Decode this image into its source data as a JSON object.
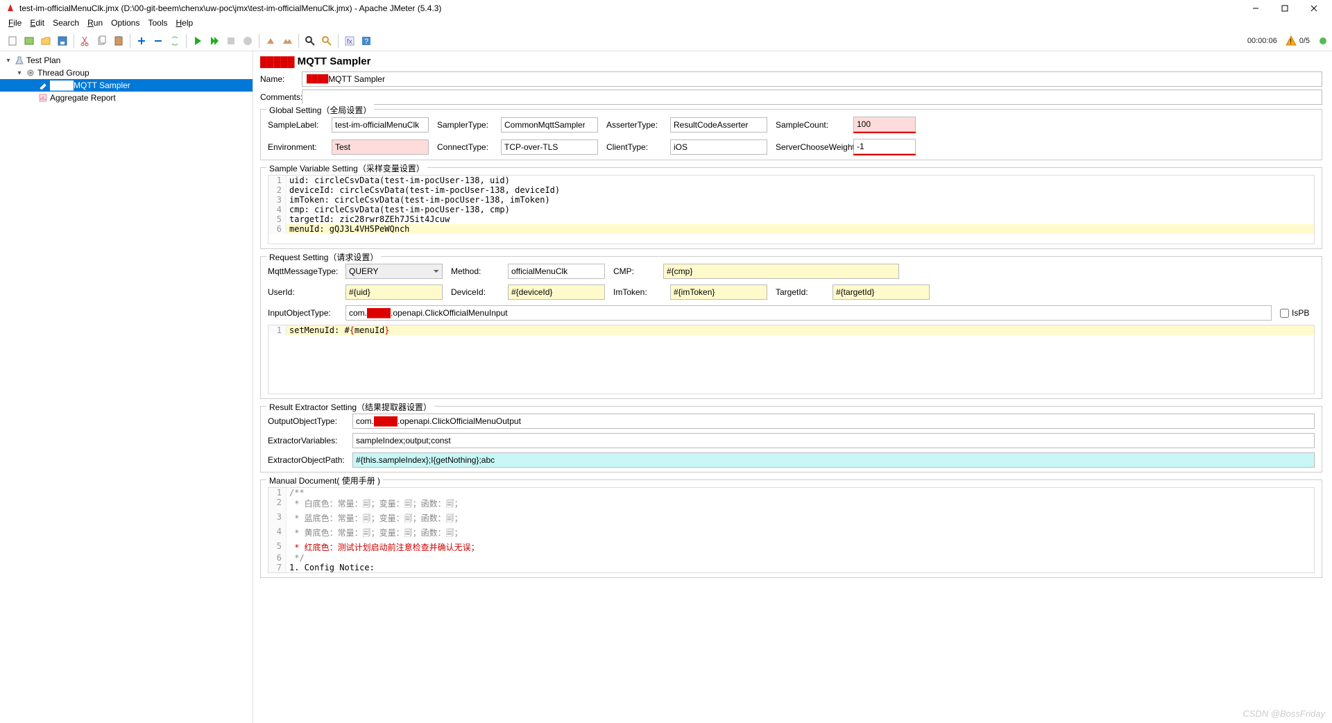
{
  "window": {
    "title": "test-im-officialMenuClk.jmx (D:\\00-git-beem\\chenx\\uw-poc\\jmx\\test-im-officialMenuClk.jmx) - Apache JMeter (5.4.3)"
  },
  "menu": {
    "file": "File",
    "edit": "Edit",
    "search": "Search",
    "run": "Run",
    "options": "Options",
    "tools": "Tools",
    "help": "Help"
  },
  "toolbar_status": {
    "time": "00:00:06",
    "threads": "0/5"
  },
  "tree": {
    "root": "Test Plan",
    "thread_group": "Thread Group",
    "mqtt_sampler_prefix": "",
    "mqtt_sampler": "MQTT Sampler",
    "aggregate": "Aggregate Report"
  },
  "panel": {
    "title_suffix": "MQTT Sampler",
    "name_label": "Name:",
    "name_value_suffix": "MQTT Sampler",
    "comments_label": "Comments:",
    "comments_value": ""
  },
  "global": {
    "legend": "Global Setting（全局设置）",
    "sample_label_l": "SampleLabel:",
    "sample_label_v": "test-im-officialMenuClk",
    "sampler_type_l": "SamplerType:",
    "sampler_type_v": "CommonMqttSampler",
    "asserter_type_l": "AsserterType:",
    "asserter_type_v": "ResultCodeAsserter",
    "sample_count_l": "SampleCount:",
    "sample_count_v": "100",
    "environment_l": "Environment:",
    "environment_v": "Test",
    "connect_type_l": "ConnectType:",
    "connect_type_v": "TCP-over-TLS",
    "client_type_l": "ClientType:",
    "client_type_v": "iOS",
    "server_weight_l": "ServerChooseWeight:",
    "server_weight_v": "-1"
  },
  "sample_var": {
    "legend": "Sample Variable Setting（采样变量设置）",
    "lines": [
      "uid: circleCsvData(test-im-pocUser-138, uid)",
      "deviceId: circleCsvData(test-im-pocUser-138, deviceId)",
      "imToken: circleCsvData(test-im-pocUser-138, imToken)",
      "cmp: circleCsvData(test-im-pocUser-138, cmp)",
      "targetId: zic28rwr8ZEh7JSit4Jcuw",
      "menuId: gQJ3L4VH5PeWQnch"
    ]
  },
  "request": {
    "legend": "Request Setting（请求设置）",
    "msg_type_l": "MqttMessageType:",
    "msg_type_v": "QUERY",
    "method_l": "Method:",
    "method_v": "officialMenuClk",
    "cmp_l": "CMP:",
    "cmp_v": "#{cmp}",
    "userid_l": "UserId:",
    "userid_v": "#{uid}",
    "deviceid_l": "DeviceId:",
    "deviceid_v": "#{deviceId}",
    "imtoken_l": "ImToken:",
    "imtoken_v": "#{imToken}",
    "targetid_l": "TargetId:",
    "targetid_v": "#{targetId}",
    "input_type_l": "InputObjectType:",
    "input_type_v": "com.xxxxx.openapi.ClickOfficialMenuInput",
    "ispb_l": "IsPB",
    "body_line": "setMenuId: #{menuId}"
  },
  "extractor": {
    "legend": "Result Extractor Setting（结果提取器设置）",
    "output_type_l": "OutputObjectType:",
    "output_type_v": "com.xxxxx.openapi.ClickOfficialMenuOutput",
    "vars_l": "ExtractorVariables:",
    "vars_v": "sampleIndex;output;const",
    "path_l": "ExtractorObjectPath:",
    "path_v": "#{this.sampleIndex};I{getNothing};abc"
  },
  "manual": {
    "legend": "Manual Document( 使用手册 )",
    "lines": [
      "/**",
      " * 白底色：常量：🗐；变量：🗐；函数：🗐；",
      " * 蓝底色：常量：🗐；变量：🗐；函数：🗐；",
      " * 黄底色：常量：🗐；变量：🗐；函数：🗐；",
      " * 红底色：测试计划启动前注意检查并确认无误；",
      " */",
      "1. Config Notice:"
    ]
  },
  "watermark": "CSDN @BossFriday"
}
